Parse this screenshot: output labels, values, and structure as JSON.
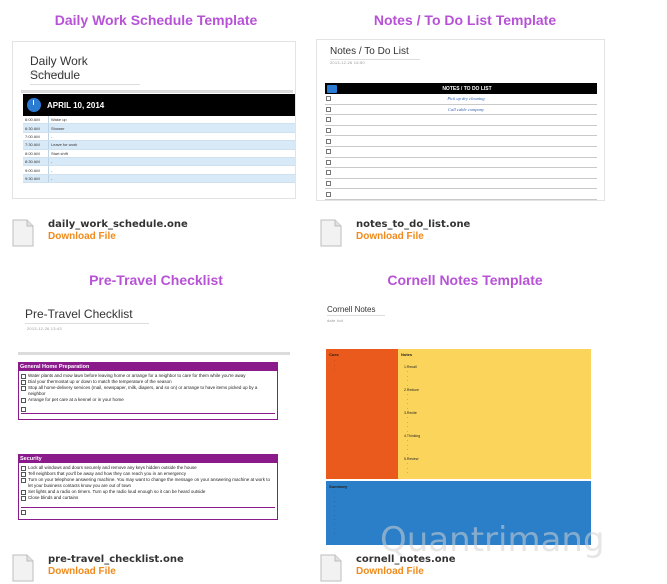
{
  "templates": [
    {
      "title": "Daily Work Schedule Template",
      "page_title": "Daily Work Schedule",
      "page_date": "2013-12-26     16:18",
      "file_name": "daily_work_schedule.one",
      "download_label": "Download File",
      "schedule_header": "APRIL 10, 2014",
      "rows": [
        {
          "time": "6:00 AM",
          "activity": "Wake up"
        },
        {
          "time": "6:30 AM",
          "activity": "Shower"
        },
        {
          "time": "7:00 AM",
          "activity": "-"
        },
        {
          "time": "7:30 AM",
          "activity": "Leave for work"
        },
        {
          "time": "8:00 AM",
          "activity": "Start shift"
        },
        {
          "time": "8:30 AM",
          "activity": "-"
        },
        {
          "time": "9:00 AM",
          "activity": "-"
        },
        {
          "time": "9:30 AM",
          "activity": "-"
        }
      ]
    },
    {
      "title": "Notes / To Do List Template",
      "page_title": "Notes / To Do List",
      "page_date": "2013-12-26     16:50",
      "file_name": "notes_to_do_list.one",
      "download_label": "Download File",
      "list_header": "NOTES / TO DO LIST",
      "items": [
        "Pick up dry cleaning",
        "Call cable company",
        "",
        "",
        "",
        "",
        "",
        "",
        "",
        ""
      ]
    },
    {
      "title": "Pre-Travel Checklist",
      "page_title": "Pre-Travel Checklist",
      "page_date": "2013-12-26     13:43",
      "file_name": "pre-travel_checklist.one",
      "download_label": "Download File",
      "sections": [
        {
          "heading": "General Home Preparation",
          "items": [
            "Water plants and mow lawn before leaving home or arrange for a neighbor to care for them while you're away",
            "Dial your thermostat up or down to match the temperature of the season",
            "Stop all home-delivery services (mail, newspaper, milk, diapers, and so on) or arrange to have items picked up by a neighbor",
            "Arrange for pet care at a kennel or in your home"
          ]
        },
        {
          "heading": "Security",
          "items": [
            "Lock all windows and doors securely and remove any keys hidden outside the house",
            "Tell neighbors that you'll be away and how they can reach you in an emergency",
            "Turn on your telephone answering machine. You may want to change the message on your answering machine at work to let your business contacts know you are out of town",
            "Set lights and a radio on timers. Turn up the radio loud enough so it can be heard outside",
            "Close blinds and curtains"
          ]
        }
      ]
    },
    {
      "title": "Cornell Notes Template",
      "page_title": "Cornell Notes",
      "page_date": "date    tod",
      "file_name": "cornell_notes.one",
      "download_label": "Download File",
      "cues_label": "Cues",
      "notes_label": "Notes",
      "note_items": [
        "1.Recall",
        "2.Reduce",
        "3.Recite",
        "4.Thinking",
        "5.Review"
      ],
      "summary_label": "Summary"
    }
  ],
  "watermark": "Quantrimang"
}
